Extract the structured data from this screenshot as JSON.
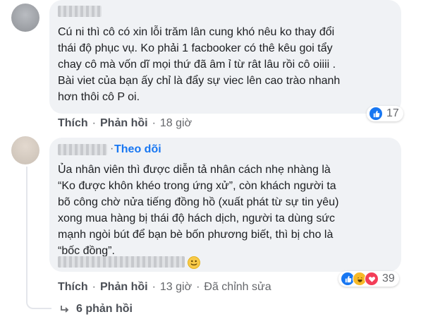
{
  "comment1": {
    "text": "Cú ni thì cô có xin lỗi trăm lân cung khó nêu ko thay đổi\nthái độ phục vụ. Ko phải 1 facbooker có thê kêu goi tẩy\nchay cô mà vốn dĩ mọi thứ đã âm ỉ từ rât lâu rồi cô oiiii .\nBài viet của bạn ấy chỉ là đẩy sự viec lên cao trào nhanh\nhơn thôi cô P oi.",
    "reaction_count": "17",
    "reactions": [
      "like"
    ],
    "like_label": "Thích",
    "reply_label": "Phản hồi",
    "time": "18 giờ"
  },
  "comment2": {
    "follow_label": "Theo dõi",
    "separator": "·",
    "text": "Ủa nhân viên thì được diễn tả nhân cách nhẹ nhàng là\n“Ko được khôn khéo trong ứng xử”, còn khách người ta\nbõ công chờ nửa tiếng đồng hồ (xuất phát từ sự tin yêu)\nxong mua hàng bị thái độ hách dịch, người ta dùng sức\nmạnh ngòi bút để bạn bè bốn phương biết, thì bị cho là\n“bốc đồng”.",
    "reaction_count": "39",
    "reactions": [
      "like",
      "haha",
      "love"
    ],
    "like_label": "Thích",
    "reply_label": "Phản hồi",
    "time": "13 giờ",
    "edited": "Đã chỉnh sửa"
  },
  "replies_link": "6 phản hồi",
  "colors": {
    "like": "#1877f2",
    "love": "#f33e58",
    "haha": "#f7b928",
    "link": "#1877f2"
  }
}
